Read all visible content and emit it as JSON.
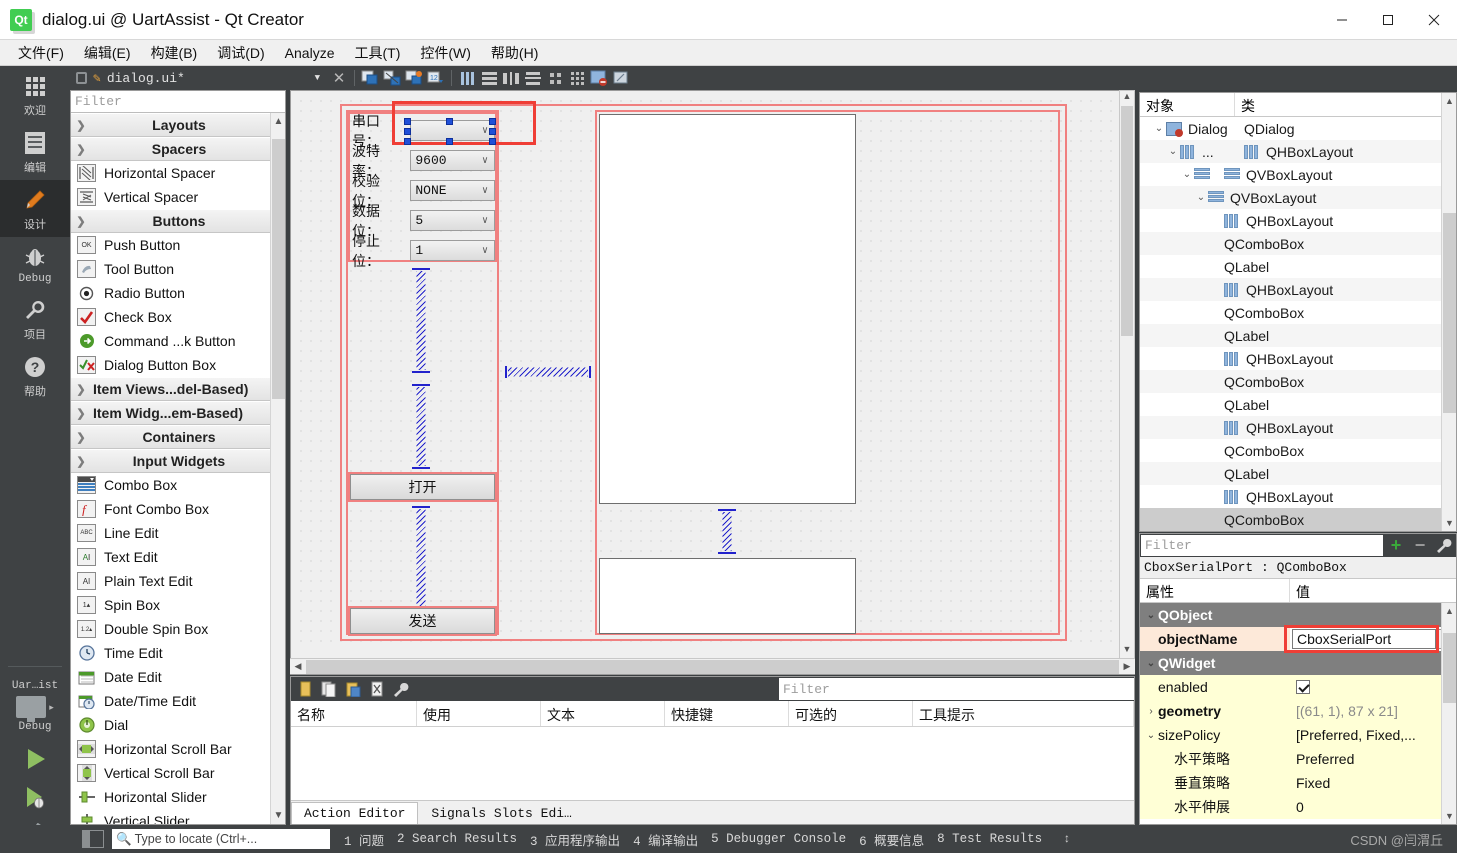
{
  "window": {
    "title": "dialog.ui @ UartAssist - Qt Creator",
    "app_icon": "qt-logo-icon",
    "minimize": "—",
    "maximize": "☐",
    "close": "✕"
  },
  "menubar": [
    {
      "label": "文件(F)",
      "mnemonic": "F"
    },
    {
      "label": "编辑(E)",
      "mnemonic": "E"
    },
    {
      "label": "构建(B)",
      "mnemonic": "B"
    },
    {
      "label": "调试(D)",
      "mnemonic": "D"
    },
    {
      "label": "Analyze",
      "mnemonic": "A"
    },
    {
      "label": "工具(T)",
      "mnemonic": "T"
    },
    {
      "label": "控件(W)",
      "mnemonic": "W"
    },
    {
      "label": "帮助(H)",
      "mnemonic": "H"
    }
  ],
  "activitybar": {
    "items": [
      {
        "label": "欢迎",
        "icon": "grid-icon",
        "active": false
      },
      {
        "label": "编辑",
        "icon": "document-icon",
        "active": false
      },
      {
        "label": "设计",
        "icon": "pencil-icon",
        "active": true
      },
      {
        "label": "Debug",
        "icon": "bug-icon",
        "active": false
      },
      {
        "label": "项目",
        "icon": "wrench-icon",
        "active": false
      },
      {
        "label": "帮助",
        "icon": "question-icon",
        "active": false
      }
    ],
    "kit": {
      "project_label": "Uar…ist",
      "build_config": "Debug",
      "monitor_icon": "monitor-icon",
      "run_icon": "run-icon",
      "debug_icon": "debug-run-icon",
      "build_icon": "hammer-icon"
    }
  },
  "editor_toolbar": {
    "lock_icon": "unlocked-icon",
    "file_icon": "edit-file-icon",
    "filename": "dialog.ui*",
    "dropdown_icon": "chevron-down-icon",
    "close_icon": "close-icon",
    "buttons": [
      "edit-widgets-icon",
      "edit-signals-slots-icon",
      "edit-buddies-icon",
      "edit-tab-order-icon",
      "layout-horizontally-icon",
      "layout-vertically-icon",
      "layout-splitter-h-icon",
      "layout-splitter-v-icon",
      "layout-grid-icon",
      "layout-form-icon",
      "break-layout-icon",
      "adjust-size-icon"
    ]
  },
  "widgetbox": {
    "filter_placeholder": "Filter",
    "groups": [
      {
        "label": "Layouts",
        "expanded": false,
        "items": []
      },
      {
        "label": "Spacers",
        "expanded": true,
        "items": [
          {
            "label": "Horizontal Spacer",
            "icon": "horizontal-spacer-icon"
          },
          {
            "label": "Vertical Spacer",
            "icon": "vertical-spacer-icon"
          }
        ]
      },
      {
        "label": "Buttons",
        "expanded": true,
        "items": [
          {
            "label": "Push Button",
            "icon": "push-button-icon"
          },
          {
            "label": "Tool Button",
            "icon": "tool-button-icon"
          },
          {
            "label": "Radio Button",
            "icon": "radio-button-icon"
          },
          {
            "label": "Check Box",
            "icon": "check-box-icon"
          },
          {
            "label": "Command ...k Button",
            "icon": "command-link-button-icon"
          },
          {
            "label": "Dialog Button Box",
            "icon": "dialog-button-box-icon"
          }
        ]
      },
      {
        "label": "Item Views...del-Based)",
        "expanded": false,
        "items": []
      },
      {
        "label": "Item Widg...em-Based)",
        "expanded": false,
        "items": []
      },
      {
        "label": "Containers",
        "expanded": false,
        "items": []
      },
      {
        "label": "Input Widgets",
        "expanded": true,
        "items": [
          {
            "label": "Combo Box",
            "icon": "combo-box-icon"
          },
          {
            "label": "Font Combo Box",
            "icon": "font-combo-box-icon"
          },
          {
            "label": "Line Edit",
            "icon": "line-edit-icon"
          },
          {
            "label": "Text Edit",
            "icon": "text-edit-icon"
          },
          {
            "label": "Plain Text Edit",
            "icon": "plain-text-edit-icon"
          },
          {
            "label": "Spin Box",
            "icon": "spin-box-icon"
          },
          {
            "label": "Double Spin Box",
            "icon": "double-spin-box-icon"
          },
          {
            "label": "Time Edit",
            "icon": "time-edit-icon"
          },
          {
            "label": "Date Edit",
            "icon": "date-edit-icon"
          },
          {
            "label": "Date/Time Edit",
            "icon": "date-time-edit-icon"
          },
          {
            "label": "Dial",
            "icon": "dial-icon"
          },
          {
            "label": "Horizontal Scroll Bar",
            "icon": "horizontal-scroll-bar-icon"
          },
          {
            "label": "Vertical Scroll Bar",
            "icon": "vertical-scroll-bar-icon"
          },
          {
            "label": "Horizontal Slider",
            "icon": "horizontal-slider-icon"
          },
          {
            "label": "Vertical Slider",
            "icon": "vertical-slider-icon"
          }
        ]
      }
    ]
  },
  "designer": {
    "form_fields": [
      {
        "label": "串口号：",
        "value": "",
        "selected": true
      },
      {
        "label": "波特率：",
        "value": "9600",
        "selected": false
      },
      {
        "label": "校验位：",
        "value": "NONE",
        "selected": false
      },
      {
        "label": "数据位：",
        "value": "5",
        "selected": false
      },
      {
        "label": "停止位：",
        "value": "1",
        "selected": false
      }
    ],
    "buttons": [
      {
        "label": "打开"
      },
      {
        "label": "发送"
      }
    ],
    "combo_chevron": "∨"
  },
  "object_inspector": {
    "columns": [
      "对象",
      "类"
    ],
    "rows": [
      {
        "indent": 0,
        "arrow": "⌄",
        "icon": "dialog-icon",
        "name": "Dialog",
        "class": "QDialog"
      },
      {
        "indent": 1,
        "arrow": "⌄",
        "icon": "hbox-layout-icon",
        "name": "...",
        "class": "QHBoxLayout"
      },
      {
        "indent": 2,
        "arrow": "⌄",
        "icon": "vbox-layout-icon",
        "name": "",
        "class": "QVBoxLayout"
      },
      {
        "indent": 3,
        "arrow": "⌄",
        "icon": "vbox-layout-icon",
        "name": "",
        "class": "QVBoxLayout"
      },
      {
        "indent": 4,
        "arrow": "",
        "icon": "hbox-layout-icon",
        "name": "",
        "class": "QHBoxLayout"
      },
      {
        "indent": 5,
        "arrow": "",
        "icon": "",
        "name": "",
        "class": "QComboBox"
      },
      {
        "indent": 5,
        "arrow": "",
        "icon": "",
        "name": "",
        "class": "QLabel"
      },
      {
        "indent": 4,
        "arrow": "",
        "icon": "hbox-layout-icon",
        "name": "",
        "class": "QHBoxLayout"
      },
      {
        "indent": 5,
        "arrow": "",
        "icon": "",
        "name": "",
        "class": "QComboBox"
      },
      {
        "indent": 5,
        "arrow": "",
        "icon": "",
        "name": "",
        "class": "QLabel"
      },
      {
        "indent": 4,
        "arrow": "",
        "icon": "hbox-layout-icon",
        "name": "",
        "class": "QHBoxLayout"
      },
      {
        "indent": 5,
        "arrow": "",
        "icon": "",
        "name": "",
        "class": "QComboBox"
      },
      {
        "indent": 5,
        "arrow": "",
        "icon": "",
        "name": "",
        "class": "QLabel"
      },
      {
        "indent": 4,
        "arrow": "",
        "icon": "hbox-layout-icon",
        "name": "",
        "class": "QHBoxLayout"
      },
      {
        "indent": 5,
        "arrow": "",
        "icon": "",
        "name": "",
        "class": "QComboBox"
      },
      {
        "indent": 5,
        "arrow": "",
        "icon": "",
        "name": "",
        "class": "QLabel"
      },
      {
        "indent": 4,
        "arrow": "",
        "icon": "hbox-layout-icon",
        "name": "",
        "class": "QHBoxLayout"
      },
      {
        "indent": 5,
        "arrow": "",
        "icon": "",
        "name": "",
        "class": "QComboBox",
        "selected": true
      }
    ]
  },
  "property_editor": {
    "filter_placeholder": "Filter",
    "add_icon": "plus-icon",
    "remove_icon": "minus-icon",
    "config_icon": "wrench-icon",
    "selected_object": "CboxSerialPort : QComboBox",
    "columns": [
      "属性",
      "值"
    ],
    "rows": [
      {
        "type": "group",
        "key": "QObject",
        "value": "",
        "arrow": "⌄"
      },
      {
        "type": "edit",
        "key": "objectName",
        "value": "CboxSerialPort",
        "arrow": "",
        "highlight": true
      },
      {
        "type": "group",
        "key": "QWidget",
        "value": "",
        "arrow": "⌄"
      },
      {
        "type": "check",
        "key": "enabled",
        "value": "",
        "arrow": "",
        "checked": true
      },
      {
        "type": "normal",
        "key": "geometry",
        "value": "[(61, 1), 87 x 21]",
        "arrow": "›",
        "bold": true
      },
      {
        "type": "normal",
        "key": "sizePolicy",
        "value": "[Preferred, Fixed,...",
        "arrow": "⌄"
      },
      {
        "type": "sub",
        "key": "水平策略",
        "value": "Preferred",
        "arrow": ""
      },
      {
        "type": "sub",
        "key": "垂直策略",
        "value": "Fixed",
        "arrow": ""
      },
      {
        "type": "sub",
        "key": "水平伸展",
        "value": "0",
        "arrow": ""
      }
    ]
  },
  "action_editor": {
    "toolbar_icons": [
      "new-action-icon",
      "copy-action-icon",
      "paste-action-icon",
      "delete-action-icon",
      "configure-icon"
    ],
    "filter_placeholder": "Filter",
    "columns": [
      "名称",
      "使用",
      "文本",
      "快捷键",
      "可选的",
      "工具提示"
    ],
    "rows": [],
    "tabs": [
      {
        "label": "Action Editor",
        "active": true
      },
      {
        "label": "Signals  Slots Edi…",
        "active": false
      }
    ]
  },
  "statusbar": {
    "sidebar_toggle_icon": "sidebar-toggle-icon",
    "locator_icon": "search-icon",
    "locator_placeholder": "Type to locate (Ctrl+...",
    "panes": [
      "1 问题",
      "2 Search Results",
      "3 应用程序输出",
      "4 编译输出",
      "5 Debugger Console",
      "6 概要信息",
      "8 Test Results"
    ],
    "updown_icon": "up-down-icon",
    "watermark": "CSDN @闫渭丘"
  },
  "colors": {
    "accent_red": "#ef3e36",
    "selection_blue": "#1f4fd8",
    "spacer_blue": "#2222cc",
    "dark_chrome": "#3f4244",
    "group_gray": "#7f7f7f",
    "prop_yellow": "#ffffd6"
  }
}
